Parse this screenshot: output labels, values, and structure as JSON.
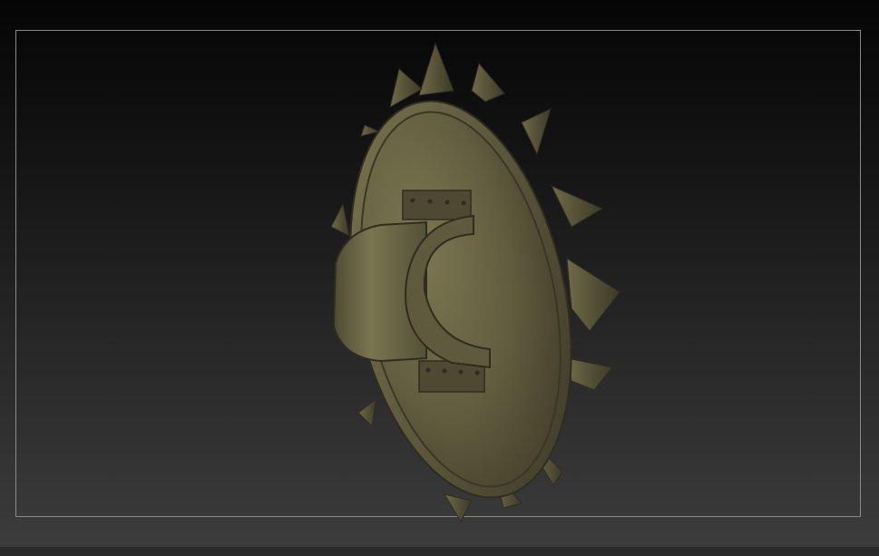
{
  "viewport": {
    "background_top": "#050505",
    "background_bottom": "#3d3d3d",
    "frame_color": "#8a8a8a"
  },
  "model": {
    "name": "shield-model",
    "material_base": "#5e5a3c",
    "material_light": "#7b7650",
    "material_dark": "#3a3726"
  }
}
